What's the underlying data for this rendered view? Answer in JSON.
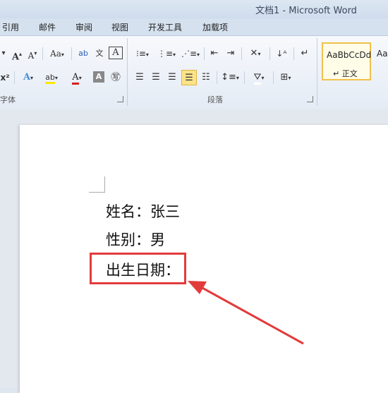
{
  "window": {
    "title": "文档1 - Microsoft Word"
  },
  "tabs": [
    "引用",
    "邮件",
    "审阅",
    "视图",
    "开发工具",
    "加载项"
  ],
  "ribbon": {
    "font_group_label": "字体",
    "paragraph_group_label": "段落",
    "style_normal_sample": "AaBbCcDd",
    "style_normal_name": "↵ 正文",
    "style_next_sample": "Aa",
    "font_grow": "A",
    "font_shrink": "A",
    "change_case": "Aa",
    "char_border": "A"
  },
  "document": {
    "lines": [
      "姓名：张三",
      "性别：男",
      "出生日期："
    ]
  },
  "colors": {
    "annotation": "#e23b3b",
    "style_selected_border": "#f1c14c"
  }
}
